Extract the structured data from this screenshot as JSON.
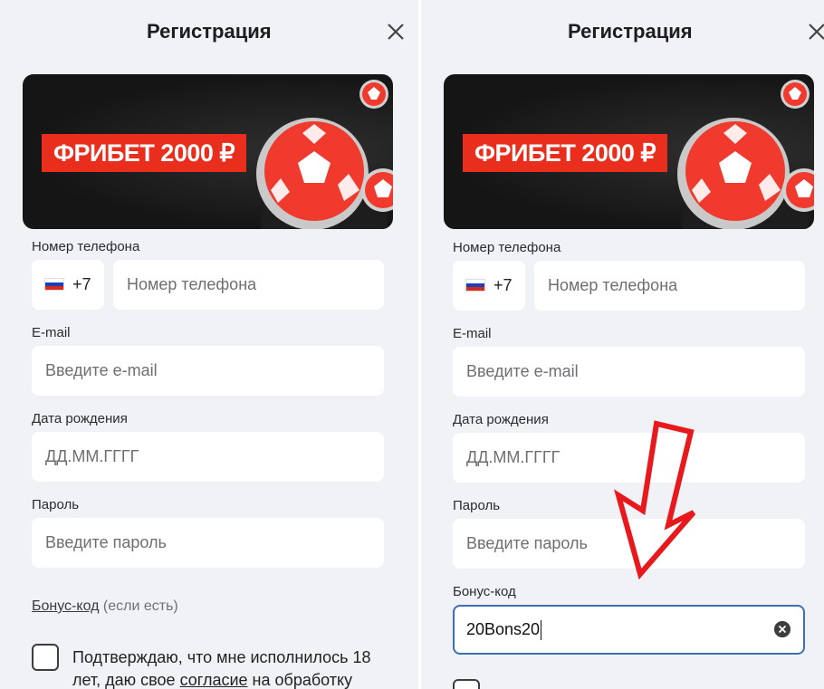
{
  "left": {
    "title": "Регистрация",
    "banner_text": "ФРИБЕТ 2000 ₽",
    "phone_label": "Номер телефона",
    "country_code": "+7",
    "phone_placeholder": "Номер телефона",
    "email_label": "E-mail",
    "email_placeholder": "Введите e-mail",
    "dob_label": "Дата рождения",
    "dob_placeholder": "ДД.ММ.ГГГГ",
    "password_label": "Пароль",
    "password_placeholder": "Введите пароль",
    "bonus_link": "Бонус-код",
    "bonus_hint": " (если есть)",
    "consent_line1": "Подтверждаю, что мне исполнилось 18",
    "consent_line2_pre": "лет, даю свое ",
    "consent_link": "согласие",
    "consent_line2_post": " на обработку"
  },
  "right": {
    "title": "Регистрация",
    "banner_text": "ФРИБЕТ 2000 ₽",
    "phone_label": "Номер телефона",
    "country_code": "+7",
    "phone_placeholder": "Номер телефона",
    "email_label": "E-mail",
    "email_placeholder": "Введите e-mail",
    "dob_label": "Дата рождения",
    "dob_placeholder": "ДД.ММ.ГГГГ",
    "password_label": "Пароль",
    "password_placeholder": "Введите пароль",
    "bonus_label": "Бонус-код",
    "bonus_value": "20Bons20"
  },
  "colors": {
    "accent_red": "#ea2e1d",
    "panel_bg": "#f1f2f6",
    "focus_border": "#3b6fb6",
    "annotation_arrow": "#e8191c"
  },
  "icons": {
    "close": "close-icon",
    "flag": "russia-flag-icon",
    "clear": "clear-input-icon",
    "arrow": "annotation-arrow"
  }
}
